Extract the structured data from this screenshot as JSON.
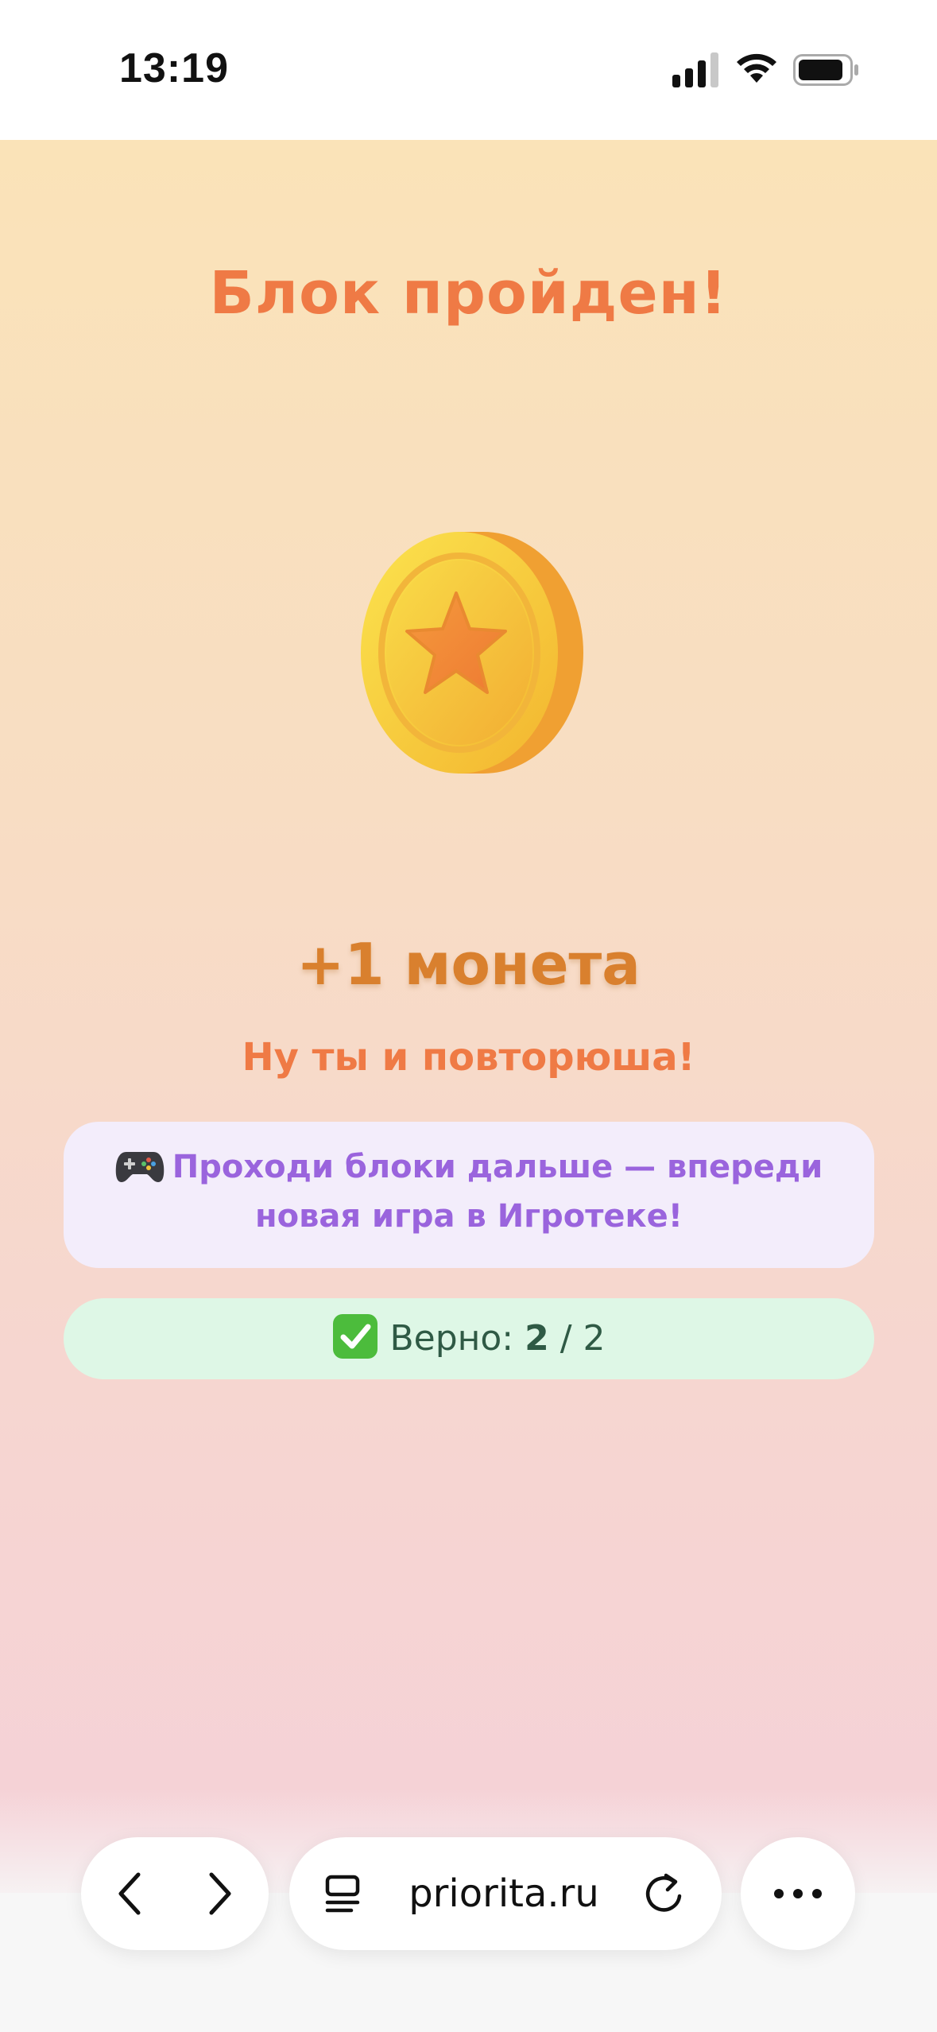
{
  "status_bar": {
    "time": "13:19",
    "icons": [
      "cellular-signal-icon",
      "wifi-icon",
      "battery-icon"
    ]
  },
  "result": {
    "title": "Блок пройден!",
    "reward_icon": "star-coin-icon",
    "reward": "+1 монета",
    "praise": "Ну ты и повторюша!"
  },
  "hint_card": {
    "icon": "gamepad-icon",
    "text": "Проходи блоки дальше — впереди новая игра в Игротеке!"
  },
  "score_card": {
    "icon": "check-mark-icon",
    "label": "Верно: ",
    "correct": "2",
    "separator": " / ",
    "total": "2"
  },
  "browser_bar": {
    "url": "priorita.ru",
    "icons": [
      "chevron-left-icon",
      "chevron-right-icon",
      "reader-icon",
      "reload-icon",
      "more-icon"
    ]
  },
  "colors": {
    "title": "#ef7a45",
    "reward": "#d9802e",
    "hint_text": "#9a64dd",
    "hint_bg": "#f3edfb",
    "score_bg": "#def7e6",
    "score_text": "#2f5a45"
  }
}
